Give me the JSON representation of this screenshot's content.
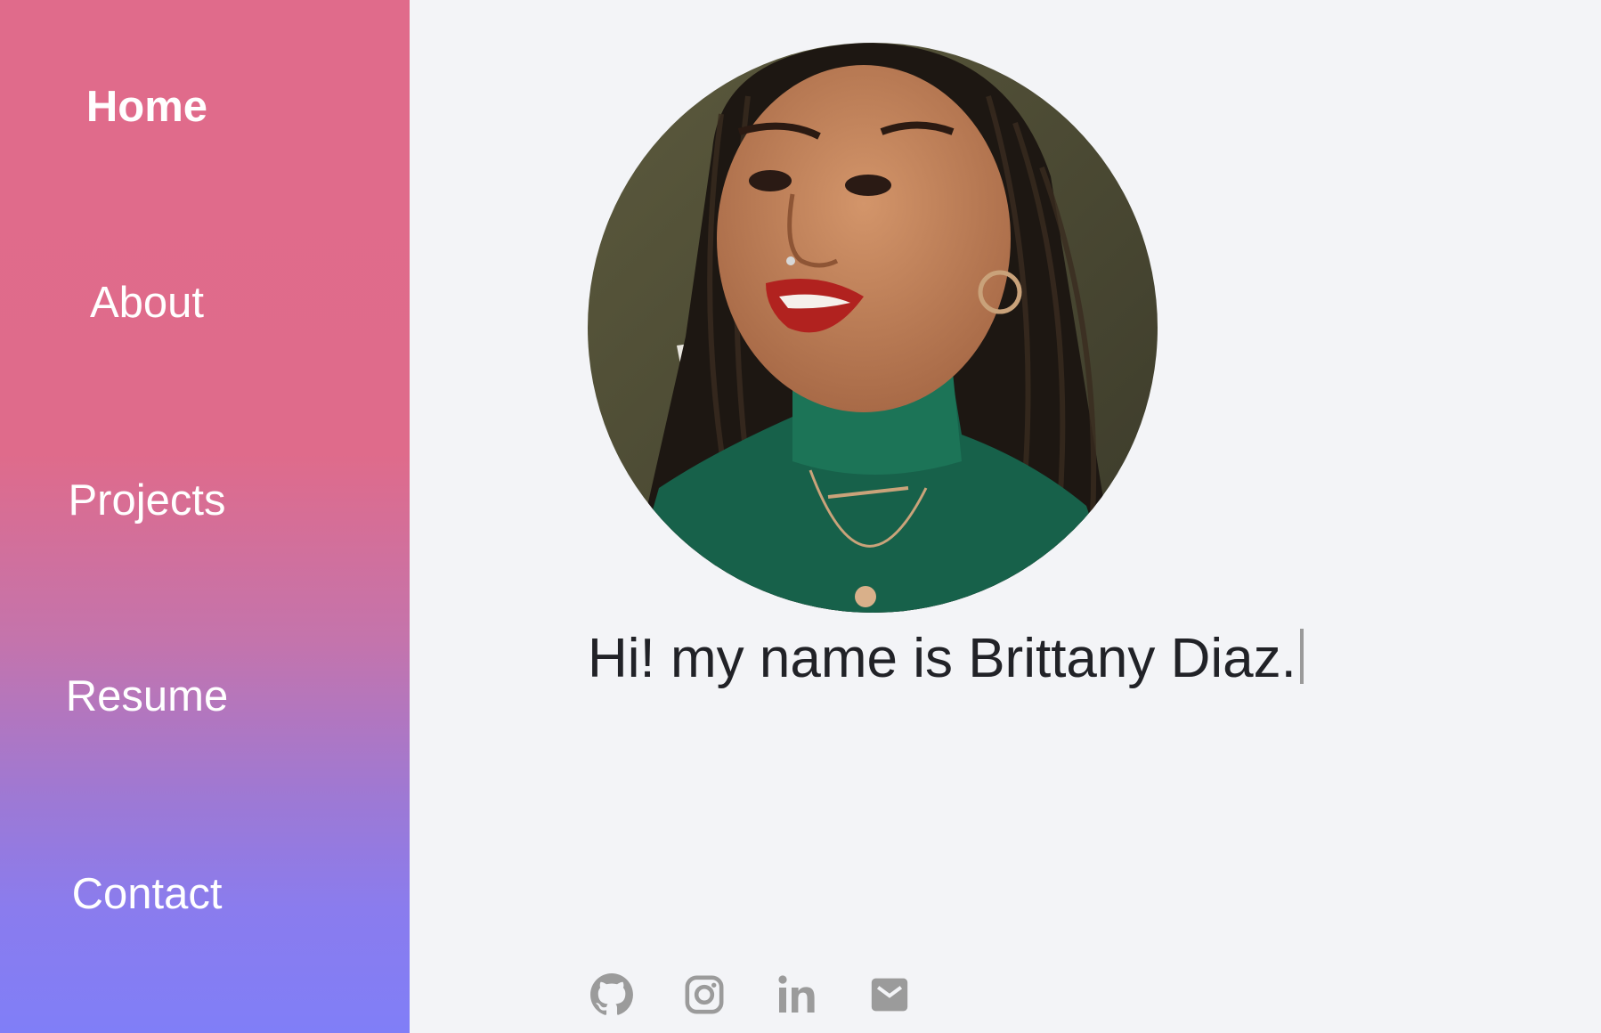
{
  "nav": {
    "items": [
      {
        "label": "Home",
        "active": true
      },
      {
        "label": "About",
        "active": false
      },
      {
        "label": "Projects",
        "active": false
      },
      {
        "label": "Resume",
        "active": false
      },
      {
        "label": "Contact",
        "active": false
      }
    ]
  },
  "hero": {
    "intro_text": "Hi! my name is Brittany Diaz."
  },
  "social_links": [
    {
      "icon": "github-icon"
    },
    {
      "icon": "instagram-icon"
    },
    {
      "icon": "linkedin-icon"
    },
    {
      "icon": "email-icon"
    }
  ],
  "colors": {
    "sidebar_top": "#e06b8b",
    "sidebar_bottom": "#807ef7",
    "page_background": "#f3f4f7",
    "icon_gray": "#9b9b9b"
  }
}
